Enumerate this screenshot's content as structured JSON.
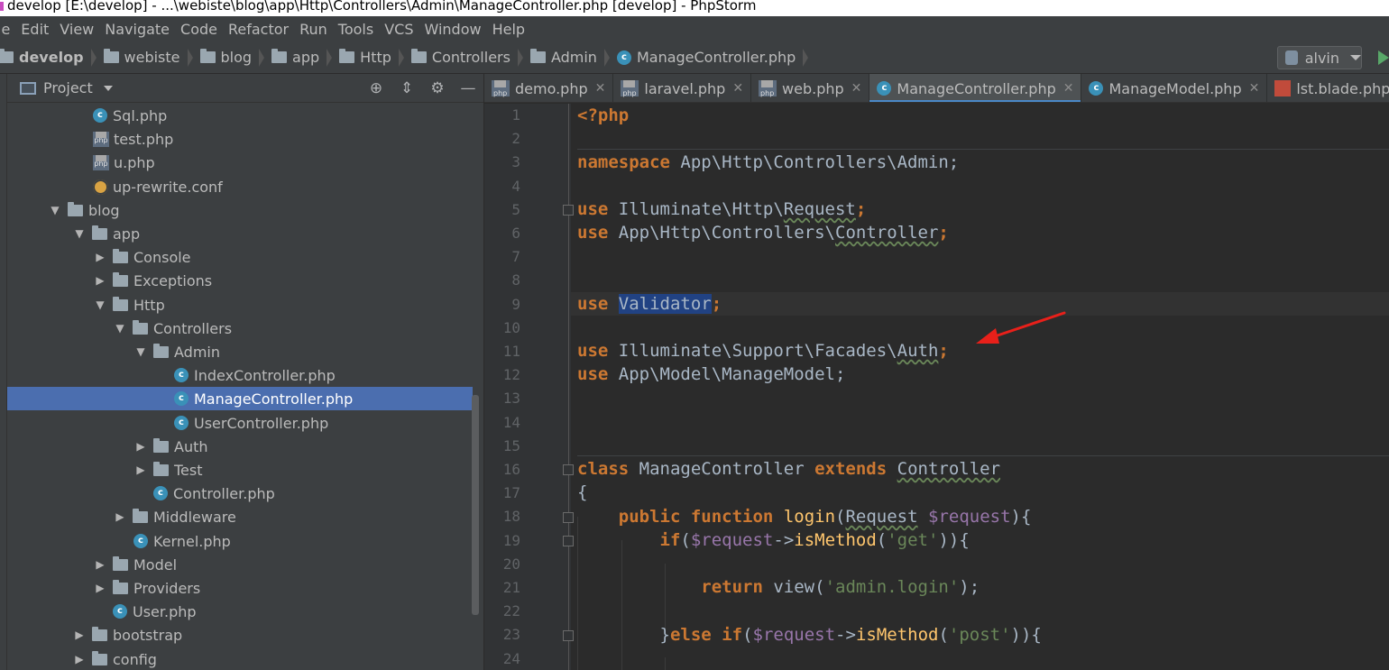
{
  "window": {
    "title": "develop [E:\\develop] - ...\\webiste\\blog\\app\\Http\\Controllers\\Admin\\ManageController.php [develop] - PhpStorm"
  },
  "menu": [
    "File",
    "Edit",
    "View",
    "Navigate",
    "Code",
    "Refactor",
    "Run",
    "Tools",
    "VCS",
    "Window",
    "Help"
  ],
  "breadcrumbs": [
    "develop",
    "webiste",
    "blog",
    "app",
    "Http",
    "Controllers",
    "Admin",
    "ManageController.php"
  ],
  "toolbar": {
    "user": "alvin"
  },
  "project_panel": {
    "title": "Project",
    "tree": [
      {
        "label": "Sql.php",
        "type": "class"
      },
      {
        "label": "test.php",
        "type": "php"
      },
      {
        "label": "u.php",
        "type": "php"
      },
      {
        "label": "up-rewrite.conf",
        "type": "conf"
      },
      {
        "label": "blog",
        "type": "folder",
        "open": true
      },
      {
        "label": "app",
        "type": "folder",
        "open": true
      },
      {
        "label": "Console",
        "type": "folder",
        "open": false
      },
      {
        "label": "Exceptions",
        "type": "folder",
        "open": false
      },
      {
        "label": "Http",
        "type": "folder",
        "open": true
      },
      {
        "label": "Controllers",
        "type": "folder",
        "open": true
      },
      {
        "label": "Admin",
        "type": "folder",
        "open": true
      },
      {
        "label": "IndexController.php",
        "type": "class"
      },
      {
        "label": "ManageController.php",
        "type": "class",
        "selected": true
      },
      {
        "label": "UserController.php",
        "type": "class"
      },
      {
        "label": "Auth",
        "type": "folder",
        "open": false
      },
      {
        "label": "Test",
        "type": "folder",
        "open": false
      },
      {
        "label": "Controller.php",
        "type": "class"
      },
      {
        "label": "Middleware",
        "type": "folder",
        "open": false
      },
      {
        "label": "Kernel.php",
        "type": "class"
      },
      {
        "label": "Model",
        "type": "folder",
        "open": false
      },
      {
        "label": "Providers",
        "type": "folder",
        "open": false
      },
      {
        "label": "User.php",
        "type": "class"
      },
      {
        "label": "bootstrap",
        "type": "folder",
        "open": false
      },
      {
        "label": "config",
        "type": "folder",
        "open": false
      }
    ]
  },
  "tabs": [
    {
      "label": "demo.php",
      "icon": "php"
    },
    {
      "label": "laravel.php",
      "icon": "php"
    },
    {
      "label": "web.php",
      "icon": "php"
    },
    {
      "label": "ManageController.php",
      "icon": "class",
      "active": true
    },
    {
      "label": "ManageModel.php",
      "icon": "class"
    },
    {
      "label": "lst.blade.php",
      "icon": "blade"
    }
  ],
  "editor": {
    "line_numbers": [
      "1",
      "2",
      "3",
      "4",
      "5",
      "6",
      "7",
      "8",
      "9",
      "10",
      "11",
      "12",
      "13",
      "14",
      "15",
      "16",
      "17",
      "18",
      "19",
      "20",
      "21",
      "22",
      "23",
      "24"
    ],
    "lines": {
      "l1": "<?php",
      "l3_kw": "namespace",
      "l3_rest": " App\\Http\\Controllers\\Admin;",
      "l5_kw": "use",
      "l5_a": " Illuminate\\Http\\",
      "l5_b": "Request",
      "l5_c": ";",
      "l6_kw": "use",
      "l6_a": " App\\Http\\Controllers\\",
      "l6_b": "Controller",
      "l6_c": ";",
      "l9_kw": "use",
      "l9_a": " ",
      "l9_b": "Validator",
      "l9_c": ";",
      "l11_kw": "use",
      "l11_a": " Illuminate\\Support\\Facades\\",
      "l11_b": "Auth",
      "l11_c": ";",
      "l12_kw": "use",
      "l12_a": " App\\Model\\ManageModel;",
      "l16_kw1": "class",
      "l16_a": " ManageController ",
      "l16_kw2": "extends",
      "l16_b": " ",
      "l16_c": "Controller",
      "l17": "{",
      "l18_kw1": "public",
      "l18_sp": " ",
      "l18_kw2": "function",
      "l18_a": " ",
      "l18_fn": "login",
      "l18_b": "(",
      "l18_c": "Request",
      "l18_d": " ",
      "l18_var": "$request",
      "l18_e": "){",
      "l19_kw": "if",
      "l19_a": "(",
      "l19_var": "$request",
      "l19_b": "->",
      "l19_fn": "isMethod",
      "l19_c": "(",
      "l19_str": "'get'",
      "l19_d": ")){",
      "l21_kw": "return",
      "l21_a": " view(",
      "l21_str": "'admin.login'",
      "l21_b": ");",
      "l23_a": "}",
      "l23_kw1": "else",
      "l23_sp": " ",
      "l23_kw2": "if",
      "l23_b": "(",
      "l23_var": "$request",
      "l23_c": "->",
      "l23_fn": "isMethod",
      "l23_d": "(",
      "l23_str": "'post'",
      "l23_e": ")){"
    }
  },
  "colors": {
    "keyword": "#cc7832",
    "function": "#ffc66d",
    "variable": "#9876aa",
    "string": "#6a8759",
    "selection": "#214283",
    "annotation_arrow": "#e8201a"
  }
}
